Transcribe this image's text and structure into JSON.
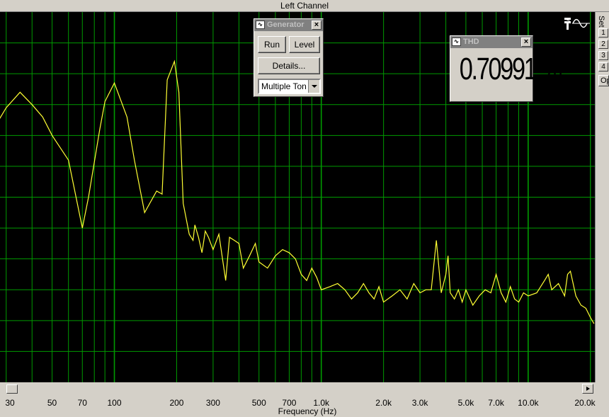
{
  "window": {
    "title": "Left Channel"
  },
  "side_panel": {
    "set_label": "Set",
    "buttons": [
      "1",
      "2",
      "3",
      "4"
    ],
    "options_button": "Op"
  },
  "generator": {
    "title": "Generator",
    "run_label": "Run",
    "level_label": "Level",
    "details_label": "Details...",
    "mode_selected": "Multiple Ton",
    "icon": "waveform-icon"
  },
  "thd": {
    "title": "THD",
    "value": "0.70991 %",
    "icon": "waveform-icon"
  },
  "axis": {
    "xlabel": "Frequency (Hz)",
    "ticks": [
      {
        "label": "30",
        "hz": 30
      },
      {
        "label": "50",
        "hz": 50
      },
      {
        "label": "70",
        "hz": 70
      },
      {
        "label": "100",
        "hz": 100
      },
      {
        "label": "200",
        "hz": 200
      },
      {
        "label": "300",
        "hz": 300
      },
      {
        "label": "500",
        "hz": 500
      },
      {
        "label": "700",
        "hz": 700
      },
      {
        "label": "1.0k",
        "hz": 1000
      },
      {
        "label": "2.0k",
        "hz": 2000
      },
      {
        "label": "3.0k",
        "hz": 3000
      },
      {
        "label": "5.0k",
        "hz": 5000
      },
      {
        "label": "7.0k",
        "hz": 7000
      },
      {
        "label": "10.0k",
        "hz": 10000
      },
      {
        "label": "20.0k",
        "hz": 20000
      }
    ]
  },
  "colors": {
    "background": "#000000",
    "grid": "#009a00",
    "trace": "#ffff33"
  },
  "chart_data": {
    "type": "line",
    "xlabel": "Frequency (Hz)",
    "x_scale": "log",
    "xlim": [
      28,
      21000
    ],
    "ylim": [
      0,
      12
    ],
    "grid": true,
    "series": [
      {
        "x": [
          26,
          30,
          35,
          40,
          45,
          50,
          60,
          70,
          75,
          85,
          90,
          100,
          115,
          125,
          140,
          160,
          170,
          180,
          195,
          205,
          215,
          230,
          240,
          245,
          255,
          265,
          275,
          285,
          300,
          320,
          345,
          360,
          380,
          400,
          420,
          450,
          480,
          500,
          550,
          600,
          650,
          700,
          750,
          800,
          850,
          900,
          950,
          1000,
          1100,
          1200,
          1300,
          1400,
          1500,
          1600,
          1700,
          1800,
          1900,
          2000,
          2200,
          2400,
          2600,
          2800,
          3000,
          3200,
          3400,
          3600,
          3800,
          4000,
          4100,
          4200,
          4400,
          4600,
          4800,
          5000,
          5400,
          5800,
          6200,
          6600,
          7000,
          7400,
          7800,
          8200,
          8600,
          9000,
          9500,
          10000,
          11000,
          12000,
          12500,
          13000,
          14000,
          15000,
          15500,
          16000,
          17000,
          18000,
          19000,
          20000,
          20800
        ],
        "y": [
          8.2,
          8.9,
          9.4,
          9.0,
          8.6,
          8.0,
          7.2,
          5.0,
          6.0,
          8.2,
          9.1,
          9.7,
          8.6,
          7.2,
          5.5,
          6.2,
          6.1,
          9.8,
          10.4,
          9.4,
          5.8,
          4.8,
          4.6,
          5.1,
          4.7,
          4.2,
          4.9,
          4.7,
          4.3,
          4.8,
          3.3,
          4.7,
          4.6,
          4.5,
          3.7,
          4.1,
          4.5,
          3.9,
          3.7,
          4.1,
          4.3,
          4.2,
          4.0,
          3.5,
          3.3,
          3.7,
          3.4,
          3.0,
          3.1,
          3.2,
          3.0,
          2.7,
          2.9,
          3.2,
          2.9,
          2.7,
          3.1,
          2.6,
          2.8,
          3.0,
          2.7,
          3.2,
          2.9,
          3.0,
          3.0,
          4.6,
          2.9,
          3.5,
          4.1,
          2.9,
          2.7,
          3.0,
          2.6,
          3.0,
          2.5,
          2.8,
          3.0,
          2.9,
          3.5,
          2.9,
          2.6,
          3.1,
          2.7,
          2.6,
          2.9,
          2.8,
          2.9,
          3.3,
          3.5,
          3.0,
          3.2,
          2.8,
          3.5,
          3.6,
          2.8,
          2.5,
          2.4,
          2.1,
          1.9
        ]
      }
    ]
  }
}
